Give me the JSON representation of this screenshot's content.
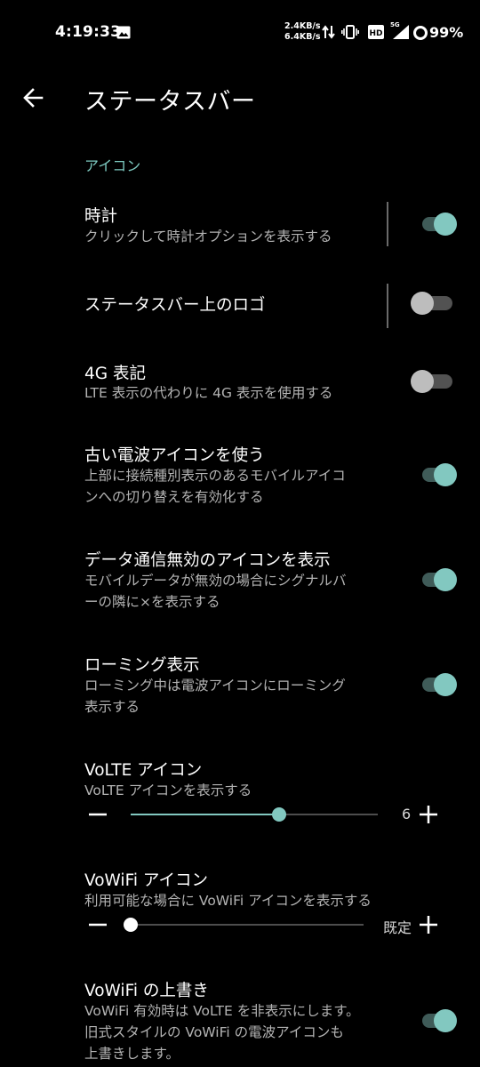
{
  "status_bar": {
    "time": "4:19:33",
    "net_up": "2.4KB/s",
    "net_down": "6.4KB/s",
    "network_type": "5G",
    "battery": "99%",
    "icons": [
      "image-icon",
      "data-arrows-icon",
      "vibrate-icon",
      "hd-icon",
      "signal-icon",
      "battery-ring-icon"
    ]
  },
  "header": {
    "title": "ステータスバー"
  },
  "section": {
    "title": "アイコン"
  },
  "items": [
    {
      "title": "時計",
      "summary": "クリックして時計オプションを表示する",
      "enabled": true
    },
    {
      "title": "ステータスバー上のロゴ",
      "summary": "",
      "enabled": false
    },
    {
      "title": "4G 表記",
      "summary": "LTE 表示の代わりに 4G 表示を使用する",
      "enabled": false
    },
    {
      "title": "古い電波アイコンを使う",
      "summary_lines": [
        "上部に接続種別表示のあるモバイルアイコ",
        "ンへの切り替えを有効化する"
      ],
      "enabled": true
    },
    {
      "title": "データ通信無効のアイコンを表示",
      "summary_lines": [
        "モバイルデータが無効の場合にシグナルバ",
        "ーの隣に×を表示する"
      ],
      "enabled": true
    },
    {
      "title": "ローミング表示",
      "summary_lines": [
        "ローミング中は電波アイコンにローミング",
        "表示する"
      ],
      "enabled": true
    },
    {
      "title": "VoLTE アイコン",
      "summary": "VoLTE アイコンを表示する",
      "slider_value": "6",
      "slider_fraction": 0.6
    },
    {
      "title": "VoWiFi アイコン",
      "summary": "利用可能な場合に VoWiFi アイコンを表示する",
      "slider_value": "既定",
      "slider_fraction": 0.0
    },
    {
      "title": "VoWiFi の上書き",
      "summary_lines": [
        "VoWiFi 有効時は VoLTE を非表示にします。",
        "旧式スタイルの VoWiFi の電波アイコンも",
        "上書きします。"
      ],
      "enabled": true
    }
  ],
  "colors": {
    "accent": "#82c8c0",
    "accent_dark": "#3f5b58",
    "section_title": "#7ecbc2",
    "background": "#000000"
  }
}
